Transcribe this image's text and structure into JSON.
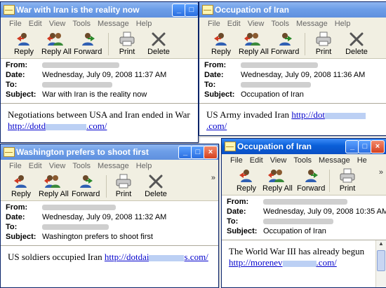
{
  "menu": [
    "File",
    "Edit",
    "View",
    "Tools",
    "Message",
    "Help"
  ],
  "menu_narrow": [
    "File",
    "Edit",
    "View",
    "Tools",
    "Message",
    "He"
  ],
  "toolbar": {
    "reply": "Reply",
    "reply_all": "Reply All",
    "forward": "Forward",
    "print": "Print",
    "delete": "Delete",
    "more": "»"
  },
  "header_labels": {
    "from": "From:",
    "date": "Date:",
    "to": "To:",
    "subject": "Subject:"
  },
  "windows": [
    {
      "title": "War with Iran is the reality now",
      "date": "Wednesday, July 09, 2008 11:37 AM",
      "subject": "War with Iran is the reality now",
      "body": "Negotiations between USA and Iran ended in War",
      "link_prefix": "http://dotd",
      "link_suffix": ".com/"
    },
    {
      "title": "Occupation of Iran",
      "date": "Wednesday, July 09, 2008 11:36 AM",
      "subject": "Occupation of Iran",
      "body": "US Army invaded Iran",
      "link_prefix": "http://dot",
      "link_suffix": ".com/"
    },
    {
      "title": "Washington prefers to shoot first",
      "date": "Wednesday, July 09, 2008 11:32 AM",
      "subject": "Washington prefers to shoot first",
      "body": "US soldiers occupied Iran",
      "link_prefix": "http://dotdai",
      "link_suffix": "s.com/"
    },
    {
      "title": "Occupation of Iran",
      "date": "Wednesday, July 09, 2008 10:35 AM",
      "subject": "Occupation of Iran",
      "body": "The World War III has already begun",
      "link_prefix": "http://morenev",
      "link_suffix": ".com/"
    }
  ],
  "colors": {
    "titlebar": "#0a5fd8",
    "toolbar_bg": "#f1efe2",
    "link": "#0000cc"
  }
}
